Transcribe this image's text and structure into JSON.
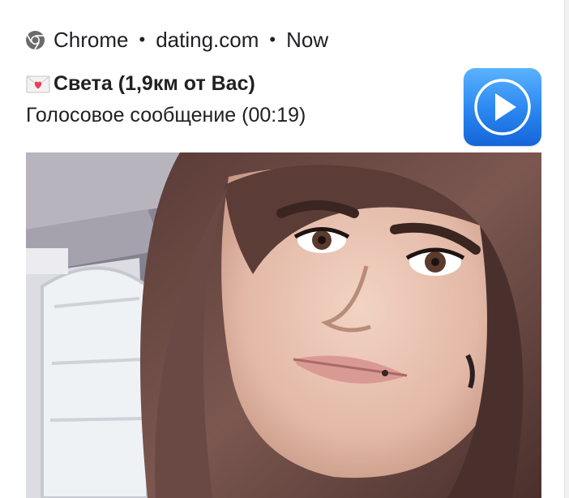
{
  "notification": {
    "app_name": "Chrome",
    "source": "dating.com",
    "time": "Now",
    "separator": "•",
    "title": "Света (1,9км от Вас)",
    "body": "Голосовое сообщение (00:19)",
    "icons": {
      "app": "chrome-icon",
      "title_prefix": "love-letter-icon",
      "action": "play-icon"
    },
    "colors": {
      "play_tile": "#2a86f0"
    }
  }
}
